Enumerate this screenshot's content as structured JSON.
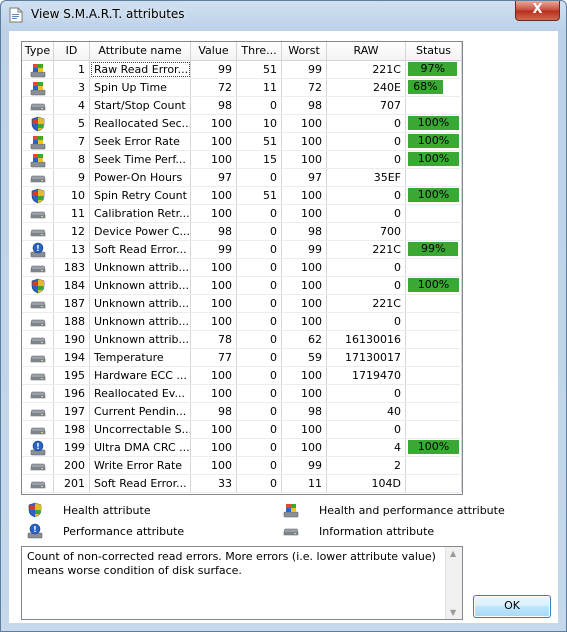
{
  "window": {
    "title": "View S.M.A.R.T. attributes",
    "close_label": "X"
  },
  "columns": [
    "Type",
    "ID",
    "Attribute name",
    "Value",
    "Thre...",
    "Worst",
    "RAW",
    "Status"
  ],
  "rows": [
    {
      "type": "health-performance",
      "id": "1",
      "name": "Raw Read Error...",
      "value": "99",
      "threshold": "51",
      "worst": "99",
      "raw": "221C",
      "status": "97%",
      "status_pct": 97
    },
    {
      "type": "health-performance",
      "id": "3",
      "name": "Spin Up Time",
      "value": "72",
      "threshold": "11",
      "worst": "72",
      "raw": "240E",
      "status": "68%",
      "status_pct": 68
    },
    {
      "type": "information",
      "id": "4",
      "name": "Start/Stop Count",
      "value": "98",
      "threshold": "0",
      "worst": "98",
      "raw": "707",
      "status": "",
      "status_pct": null
    },
    {
      "type": "health",
      "id": "5",
      "name": "Reallocated Sec...",
      "value": "100",
      "threshold": "10",
      "worst": "100",
      "raw": "0",
      "status": "100%",
      "status_pct": 100
    },
    {
      "type": "health-performance",
      "id": "7",
      "name": "Seek Error Rate",
      "value": "100",
      "threshold": "51",
      "worst": "100",
      "raw": "0",
      "status": "100%",
      "status_pct": 100
    },
    {
      "type": "health-performance",
      "id": "8",
      "name": "Seek Time Perf...",
      "value": "100",
      "threshold": "15",
      "worst": "100",
      "raw": "0",
      "status": "100%",
      "status_pct": 100
    },
    {
      "type": "information",
      "id": "9",
      "name": "Power-On Hours",
      "value": "97",
      "threshold": "0",
      "worst": "97",
      "raw": "35EF",
      "status": "",
      "status_pct": null
    },
    {
      "type": "health",
      "id": "10",
      "name": "Spin Retry Count",
      "value": "100",
      "threshold": "51",
      "worst": "100",
      "raw": "0",
      "status": "100%",
      "status_pct": 100
    },
    {
      "type": "information",
      "id": "11",
      "name": "Calibration Retr...",
      "value": "100",
      "threshold": "0",
      "worst": "100",
      "raw": "0",
      "status": "",
      "status_pct": null
    },
    {
      "type": "information",
      "id": "12",
      "name": "Device Power C...",
      "value": "98",
      "threshold": "0",
      "worst": "98",
      "raw": "700",
      "status": "",
      "status_pct": null
    },
    {
      "type": "performance",
      "id": "13",
      "name": "Soft Read Error...",
      "value": "99",
      "threshold": "0",
      "worst": "99",
      "raw": "221C",
      "status": "99%",
      "status_pct": 99
    },
    {
      "type": "information",
      "id": "183",
      "name": "Unknown attrib...",
      "value": "100",
      "threshold": "0",
      "worst": "100",
      "raw": "0",
      "status": "",
      "status_pct": null
    },
    {
      "type": "health",
      "id": "184",
      "name": "Unknown attrib...",
      "value": "100",
      "threshold": "0",
      "worst": "100",
      "raw": "0",
      "status": "100%",
      "status_pct": 100
    },
    {
      "type": "information",
      "id": "187",
      "name": "Unknown attrib...",
      "value": "100",
      "threshold": "0",
      "worst": "100",
      "raw": "221C",
      "status": "",
      "status_pct": null
    },
    {
      "type": "information",
      "id": "188",
      "name": "Unknown attrib...",
      "value": "100",
      "threshold": "0",
      "worst": "100",
      "raw": "0",
      "status": "",
      "status_pct": null
    },
    {
      "type": "information",
      "id": "190",
      "name": "Unknown attrib...",
      "value": "78",
      "threshold": "0",
      "worst": "62",
      "raw": "16130016",
      "status": "",
      "status_pct": null
    },
    {
      "type": "information",
      "id": "194",
      "name": "Temperature",
      "value": "77",
      "threshold": "0",
      "worst": "59",
      "raw": "17130017",
      "status": "",
      "status_pct": null
    },
    {
      "type": "information",
      "id": "195",
      "name": "Hardware ECC ...",
      "value": "100",
      "threshold": "0",
      "worst": "100",
      "raw": "1719470",
      "status": "",
      "status_pct": null
    },
    {
      "type": "information",
      "id": "196",
      "name": "Reallocated Ev...",
      "value": "100",
      "threshold": "0",
      "worst": "100",
      "raw": "0",
      "status": "",
      "status_pct": null
    },
    {
      "type": "information",
      "id": "197",
      "name": "Current Pendin...",
      "value": "98",
      "threshold": "0",
      "worst": "98",
      "raw": "40",
      "status": "",
      "status_pct": null
    },
    {
      "type": "information",
      "id": "198",
      "name": "Uncorrectable S...",
      "value": "100",
      "threshold": "0",
      "worst": "100",
      "raw": "0",
      "status": "",
      "status_pct": null
    },
    {
      "type": "performance",
      "id": "199",
      "name": "Ultra DMA CRC ...",
      "value": "100",
      "threshold": "0",
      "worst": "100",
      "raw": "4",
      "status": "100%",
      "status_pct": 100
    },
    {
      "type": "information",
      "id": "200",
      "name": "Write Error Rate",
      "value": "100",
      "threshold": "0",
      "worst": "99",
      "raw": "2",
      "status": "",
      "status_pct": null
    },
    {
      "type": "information",
      "id": "201",
      "name": "Soft Read Error...",
      "value": "33",
      "threshold": "0",
      "worst": "11",
      "raw": "104D",
      "status": "",
      "status_pct": null
    }
  ],
  "legend": {
    "health": "Health attribute",
    "health_performance": "Health and performance attribute",
    "performance": "Performance attribute",
    "information": "Information attribute"
  },
  "description": "Count of non-corrected read errors. More errors (i.e. lower attribute value) means worse condition of disk surface.",
  "ok_label": "OK",
  "colors": {
    "status_bar": "#3aa934",
    "close_button": "#c8493a"
  },
  "icons": {
    "health": "shield-icon",
    "health-performance": "windows-flag-disk-icon",
    "performance": "gauge-disk-icon",
    "information": "disk-icon"
  }
}
